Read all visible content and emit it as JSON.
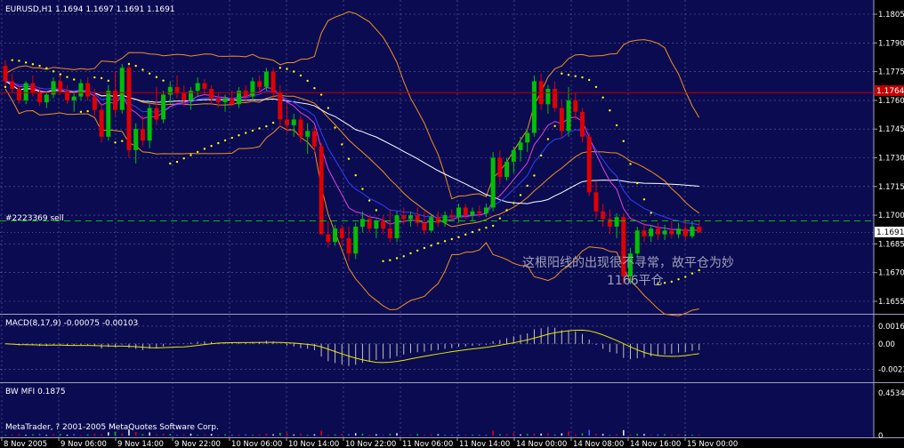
{
  "header": {
    "symbol_line": "EURUSD,H1  1.1694 1.1697 1.1691 1.1691",
    "order_label": "#2223369 sell",
    "macd_label": "MACD(8,17,9) -0.00075 -0.00103",
    "mfi_label": "BW MFI 0.1875",
    "copyright": "MetaTrader, ? 2001-2005 MetaQuotes Software Corp."
  },
  "annotations": {
    "line1": "这根阳线的出现很不寻常，故平仓为妙",
    "line2": "1166平仓"
  },
  "colors": {
    "background": "#000000",
    "plot_bg": "#0b0b52",
    "grid": "#a0a0c0",
    "up_candle": "#00c000",
    "down_candle": "#e00000",
    "bollinger": "#f09020",
    "ma_slow": "#ffffff",
    "ma_fast": "#e040e0",
    "ma_mid": "#3040ff",
    "sar": "#ffff00",
    "macd_signal": "#e8e800",
    "resistance": "#c00000",
    "order_line": "#00c000",
    "price_tag": "#ffffff",
    "resistance_tag": "#c00000"
  },
  "chart_data": {
    "type": "candlestick",
    "symbol": "EURUSD",
    "timeframe": "H1",
    "y_axis_ticks": [
      "1.1805",
      "1.1790",
      "1.1775",
      "1.1760",
      "1.1745",
      "1.1730",
      "1.1715",
      "1.1700",
      "1.1685",
      "1.1670",
      "1.1655"
    ],
    "ylim": [
      1.165,
      1.181
    ],
    "x_axis_ticks": [
      "8 Nov 2005",
      "9 Nov 06:00",
      "9 Nov 14:00",
      "9 Nov 22:00",
      "10 Nov 06:00",
      "10 Nov 14:00",
      "10 Nov 22:00",
      "11 Nov 06:00",
      "11 Nov 14:00",
      "14 Nov 00:00",
      "14 Nov 08:00",
      "14 Nov 16:00",
      "15 Nov 00:00"
    ],
    "current_price": "1.1691",
    "resistance_price": "1.1764",
    "order_line_price": 1.1697,
    "candles": [
      [
        1.1778,
        1.1781,
        1.1767,
        1.177
      ],
      [
        1.177,
        1.1774,
        1.1764,
        1.1766
      ],
      [
        1.1766,
        1.1768,
        1.1758,
        1.176
      ],
      [
        1.176,
        1.177,
        1.1758,
        1.1769
      ],
      [
        1.1769,
        1.1773,
        1.1762,
        1.1764
      ],
      [
        1.1764,
        1.1767,
        1.1757,
        1.1759
      ],
      [
        1.1759,
        1.1765,
        1.1756,
        1.1763
      ],
      [
        1.1763,
        1.1772,
        1.1761,
        1.177
      ],
      [
        1.177,
        1.1773,
        1.1763,
        1.1765
      ],
      [
        1.1765,
        1.1768,
        1.1758,
        1.176
      ],
      [
        1.176,
        1.1765,
        1.1754,
        1.1762
      ],
      [
        1.1762,
        1.1771,
        1.176,
        1.1769
      ],
      [
        1.1769,
        1.1772,
        1.176,
        1.1762
      ],
      [
        1.1762,
        1.1766,
        1.1752,
        1.1755
      ],
      [
        1.1755,
        1.1758,
        1.1738,
        1.1741
      ],
      [
        1.1741,
        1.1768,
        1.1739,
        1.1765
      ],
      [
        1.1765,
        1.1775,
        1.1752,
        1.1755
      ],
      [
        1.1755,
        1.1779,
        1.1753,
        1.1777
      ],
      [
        1.1777,
        1.1779,
        1.173,
        1.1734
      ],
      [
        1.1734,
        1.1748,
        1.1727,
        1.1745
      ],
      [
        1.1745,
        1.1752,
        1.1736,
        1.1739
      ],
      [
        1.1739,
        1.1758,
        1.1735,
        1.1756
      ],
      [
        1.1756,
        1.1767,
        1.1747,
        1.175
      ],
      [
        1.175,
        1.1765,
        1.1748,
        1.1763
      ],
      [
        1.1763,
        1.177,
        1.1758,
        1.1767
      ],
      [
        1.1767,
        1.1773,
        1.1761,
        1.1764
      ],
      [
        1.1764,
        1.1768,
        1.1757,
        1.176
      ],
      [
        1.176,
        1.1767,
        1.1755,
        1.1765
      ],
      [
        1.1765,
        1.1772,
        1.1762,
        1.1769
      ],
      [
        1.1769,
        1.1771,
        1.1763,
        1.1766
      ],
      [
        1.1766,
        1.1768,
        1.1758,
        1.1761
      ],
      [
        1.1761,
        1.1764,
        1.1756,
        1.1759
      ],
      [
        1.1759,
        1.1763,
        1.1754,
        1.1761
      ],
      [
        1.1761,
        1.1765,
        1.1757,
        1.1758
      ],
      [
        1.1758,
        1.1767,
        1.1756,
        1.1765
      ],
      [
        1.1765,
        1.1768,
        1.1759,
        1.1762
      ],
      [
        1.1762,
        1.1772,
        1.176,
        1.177
      ],
      [
        1.177,
        1.1773,
        1.1764,
        1.1767
      ],
      [
        1.1767,
        1.1777,
        1.1765,
        1.1775
      ],
      [
        1.1775,
        1.1777,
        1.1761,
        1.1764
      ],
      [
        1.1764,
        1.1768,
        1.1746,
        1.175
      ],
      [
        1.175,
        1.1758,
        1.1743,
        1.1747
      ],
      [
        1.1747,
        1.1753,
        1.1741,
        1.175
      ],
      [
        1.175,
        1.1752,
        1.1738,
        1.1741
      ],
      [
        1.1741,
        1.1748,
        1.1732,
        1.1744
      ],
      [
        1.1744,
        1.1746,
        1.1733,
        1.1736
      ],
      [
        1.1736,
        1.1738,
        1.1705,
        1.169
      ],
      [
        1.169,
        1.1697,
        1.1683,
        1.1686
      ],
      [
        1.1686,
        1.1695,
        1.1684,
        1.1693
      ],
      [
        1.1693,
        1.1695,
        1.1684,
        1.1688
      ],
      [
        1.1688,
        1.1694,
        1.1676,
        1.168
      ],
      [
        1.168,
        1.1696,
        1.1677,
        1.1694
      ],
      [
        1.1694,
        1.1702,
        1.1691,
        1.1698
      ],
      [
        1.1698,
        1.17,
        1.1691,
        1.1693
      ],
      [
        1.1693,
        1.1698,
        1.1688,
        1.1697
      ],
      [
        1.1697,
        1.17,
        1.169,
        1.1693
      ],
      [
        1.1693,
        1.1703,
        1.1686,
        1.1688
      ],
      [
        1.1688,
        1.1702,
        1.1686,
        1.17
      ],
      [
        1.17,
        1.1704,
        1.1695,
        1.1698
      ],
      [
        1.1698,
        1.1702,
        1.1694,
        1.17
      ],
      [
        1.17,
        1.1704,
        1.1694,
        1.1696
      ],
      [
        1.1696,
        1.1702,
        1.169,
        1.1692
      ],
      [
        1.1692,
        1.17,
        1.1691,
        1.1699
      ],
      [
        1.1699,
        1.1702,
        1.1694,
        1.1696
      ],
      [
        1.1696,
        1.1702,
        1.1694,
        1.17
      ],
      [
        1.17,
        1.1703,
        1.1697,
        1.1699
      ],
      [
        1.1699,
        1.1706,
        1.1696,
        1.1704
      ],
      [
        1.1704,
        1.1706,
        1.1698,
        1.17
      ],
      [
        1.17,
        1.1704,
        1.1697,
        1.1702
      ],
      [
        1.1702,
        1.1705,
        1.1699,
        1.1701
      ],
      [
        1.1701,
        1.1706,
        1.1699,
        1.1704
      ],
      [
        1.1704,
        1.1733,
        1.1702,
        1.173
      ],
      [
        1.173,
        1.1734,
        1.1716,
        1.172
      ],
      [
        1.172,
        1.173,
        1.1718,
        1.1728
      ],
      [
        1.1728,
        1.1736,
        1.1722,
        1.1734
      ],
      [
        1.1734,
        1.1741,
        1.1728,
        1.1738
      ],
      [
        1.1738,
        1.1745,
        1.1733,
        1.1743
      ],
      [
        1.1743,
        1.1773,
        1.1741,
        1.177
      ],
      [
        1.177,
        1.1774,
        1.1755,
        1.1758
      ],
      [
        1.1758,
        1.1768,
        1.1753,
        1.1766
      ],
      [
        1.1766,
        1.177,
        1.1754,
        1.1756
      ],
      [
        1.1756,
        1.176,
        1.174,
        1.1744
      ],
      [
        1.1744,
        1.1767,
        1.1741,
        1.176
      ],
      [
        1.176,
        1.1764,
        1.175,
        1.1754
      ],
      [
        1.1754,
        1.1756,
        1.1738,
        1.1741
      ],
      [
        1.1741,
        1.1743,
        1.171,
        1.1712
      ],
      [
        1.1712,
        1.1718,
        1.1698,
        1.1702
      ],
      [
        1.1702,
        1.1706,
        1.1694,
        1.1698
      ],
      [
        1.1698,
        1.1703,
        1.169,
        1.1694
      ],
      [
        1.1694,
        1.1701,
        1.1688,
        1.1699
      ],
      [
        1.1699,
        1.1701,
        1.1664,
        1.1668
      ],
      [
        1.1668,
        1.1683,
        1.1664,
        1.168
      ],
      [
        1.168,
        1.1694,
        1.1678,
        1.1692
      ],
      [
        1.1692,
        1.1696,
        1.1686,
        1.1689
      ],
      [
        1.1689,
        1.1695,
        1.1686,
        1.1693
      ],
      [
        1.1693,
        1.1696,
        1.1687,
        1.169
      ],
      [
        1.169,
        1.1695,
        1.1687,
        1.1692
      ],
      [
        1.1692,
        1.1697,
        1.1688,
        1.169
      ],
      [
        1.169,
        1.1696,
        1.1688,
        1.1693
      ],
      [
        1.1693,
        1.1698,
        1.1687,
        1.1689
      ],
      [
        1.1689,
        1.1697,
        1.1688,
        1.1694
      ],
      [
        1.1694,
        1.1697,
        1.1691,
        1.1691
      ]
    ],
    "macd": {
      "ticks": [
        "0.0016",
        "0.00",
        "-0.00232"
      ],
      "ylim": [
        -0.003,
        0.002
      ]
    },
    "mfi": {
      "ticks": [
        "0.4534",
        "0"
      ],
      "ylim": [
        0,
        0.47
      ]
    }
  }
}
